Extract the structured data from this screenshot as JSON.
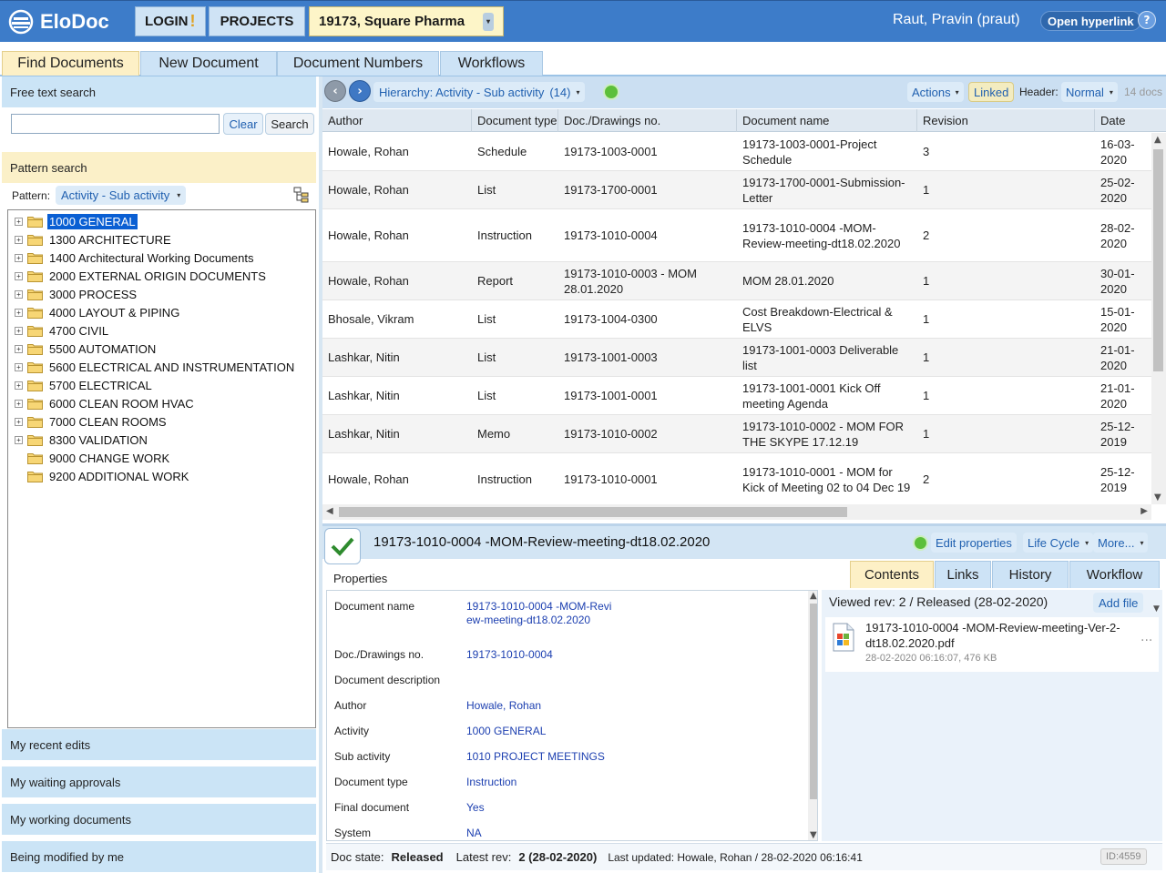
{
  "header": {
    "logo_text": "EloDoc",
    "login_label": "LOGIN",
    "projects_label": "PROJECTS",
    "project_label": "19173, Square Pharma",
    "user_name": "Raut, Pravin (praut)",
    "open_hyperlink_label": "Open hyperlink",
    "help_symbol": "?"
  },
  "main_tabs": [
    "Find Documents",
    "New Document",
    "Document Numbers",
    "Workflows"
  ],
  "left": {
    "free_text_title": "Free text search",
    "search_value": "",
    "clear_label": "Clear",
    "search_label": "Search",
    "pattern_title": "Pattern search",
    "pattern_label": "Pattern:",
    "pattern_value": "Activity - Sub activity",
    "tree": [
      {
        "label": "1000 GENERAL",
        "selected": true,
        "expandable": true
      },
      {
        "label": "1300 ARCHITECTURE",
        "expandable": true
      },
      {
        "label": "1400 Architectural Working Documents",
        "expandable": true
      },
      {
        "label": "2000 EXTERNAL ORIGIN DOCUMENTS",
        "expandable": true
      },
      {
        "label": "3000 PROCESS",
        "expandable": true
      },
      {
        "label": "4000 LAYOUT & PIPING",
        "expandable": true
      },
      {
        "label": "4700 CIVIL",
        "expandable": true
      },
      {
        "label": "5500 AUTOMATION",
        "expandable": true
      },
      {
        "label": "5600 ELECTRICAL AND INSTRUMENTATION",
        "expandable": true
      },
      {
        "label": "5700 ELECTRICAL",
        "expandable": true
      },
      {
        "label": "6000 CLEAN ROOM HVAC",
        "expandable": true
      },
      {
        "label": "7000 CLEAN ROOMS",
        "expandable": true
      },
      {
        "label": "8300 VALIDATION",
        "expandable": true
      },
      {
        "label": "9000 CHANGE WORK",
        "expandable": false
      },
      {
        "label": "9200 ADDITIONAL WORK",
        "expandable": false
      }
    ],
    "bottom_sections": [
      "My recent edits",
      "My waiting approvals",
      "My working documents",
      "Being modified by me"
    ]
  },
  "toolbar": {
    "hierarchy_label": "Hierarchy: Activity - Sub activity",
    "hierarchy_count": "(14)",
    "actions_label": "Actions",
    "linked_label": "Linked",
    "header_label": "Header:",
    "header_value": "Normal",
    "docs_count": "14 docs"
  },
  "grid": {
    "columns": [
      "Author",
      "Document type",
      "Doc./Drawings no.",
      "Document name",
      "Revision",
      "Date"
    ],
    "rows": [
      [
        "Howale, Rohan",
        "Schedule",
        "19173-1003-0001",
        "19173-1003-0001-Project Schedule",
        "3",
        "16-03-2020"
      ],
      [
        "Howale, Rohan",
        "List",
        "19173-1700-0001",
        "19173-1700-0001-Submission-Letter",
        "1",
        "25-02-2020"
      ],
      [
        "Howale, Rohan",
        "Instruction",
        "19173-1010-0004",
        "19173-1010-0004 -MOM-Review-meeting-dt18.02.2020",
        "2",
        "28-02-2020"
      ],
      [
        "Howale, Rohan",
        "Report",
        "19173-1010-0003 - MOM 28.01.2020",
        "MOM 28.01.2020",
        "1",
        "30-01-2020"
      ],
      [
        "Bhosale, Vikram",
        "List",
        "19173-1004-0300",
        "Cost Breakdown-Electrical & ELVS",
        "1",
        "15-01-2020"
      ],
      [
        "Lashkar, Nitin",
        "List",
        "19173-1001-0003",
        "19173-1001-0003 Deliverable list",
        "1",
        "21-01-2020"
      ],
      [
        "Lashkar, Nitin",
        "List",
        "19173-1001-0001",
        "19173-1001-0001 Kick Off meeting Agenda",
        "1",
        "21-01-2020"
      ],
      [
        "Lashkar, Nitin",
        "Memo",
        "19173-1010-0002",
        "19173-1010-0002 - MOM FOR THE SKYPE 17.12.19",
        "1",
        "25-12-2019"
      ],
      [
        "Howale, Rohan",
        "Instruction",
        "19173-1010-0001",
        "19173-1010-0001 - MOM for Kick of Meeting 02 to 04 Dec 19",
        "2",
        "25-12-2019"
      ]
    ]
  },
  "detail": {
    "title": "19173-1010-0004 -MOM-Review-meeting-dt18.02.2020",
    "edit_properties_label": "Edit properties",
    "life_cycle_label": "Life Cycle",
    "more_label": "More...",
    "properties_label": "Properties",
    "tabs": [
      "Contents",
      "Links",
      "History",
      "Workflow"
    ],
    "properties": [
      {
        "key": "Document name",
        "value": "19173-1010-0004 -MOM-Review-meeting-dt18.02.2020"
      },
      {
        "key": "Doc./Drawings no.",
        "value": "19173-1010-0004"
      },
      {
        "key": "Document description",
        "value": ""
      },
      {
        "key": "Author",
        "value": "Howale, Rohan"
      },
      {
        "key": "Activity",
        "value": "1000 GENERAL"
      },
      {
        "key": "Sub activity",
        "value": "1010 PROJECT MEETINGS"
      },
      {
        "key": "Document type",
        "value": "Instruction"
      },
      {
        "key": "Final document",
        "value": "Yes"
      },
      {
        "key": "System",
        "value": "NA"
      }
    ],
    "viewed_rev": "Viewed rev: 2 / Released (28-02-2020)",
    "add_file_label": "Add file",
    "file_name": "19173-1010-0004 -MOM-Review-meeting-Ver-2-dt18.02.2020.pdf",
    "file_meta": "28-02-2020 06:16:07, 476 KB",
    "file_more": "...",
    "status": {
      "doc_state_label": "Doc state:",
      "doc_state_value": "Released",
      "latest_rev_label": "Latest rev:",
      "latest_rev_value": "2 (28-02-2020)",
      "last_updated": "Last updated: Howale, Rohan / 28-02-2020 06:16:41",
      "id": "ID:4559"
    }
  }
}
